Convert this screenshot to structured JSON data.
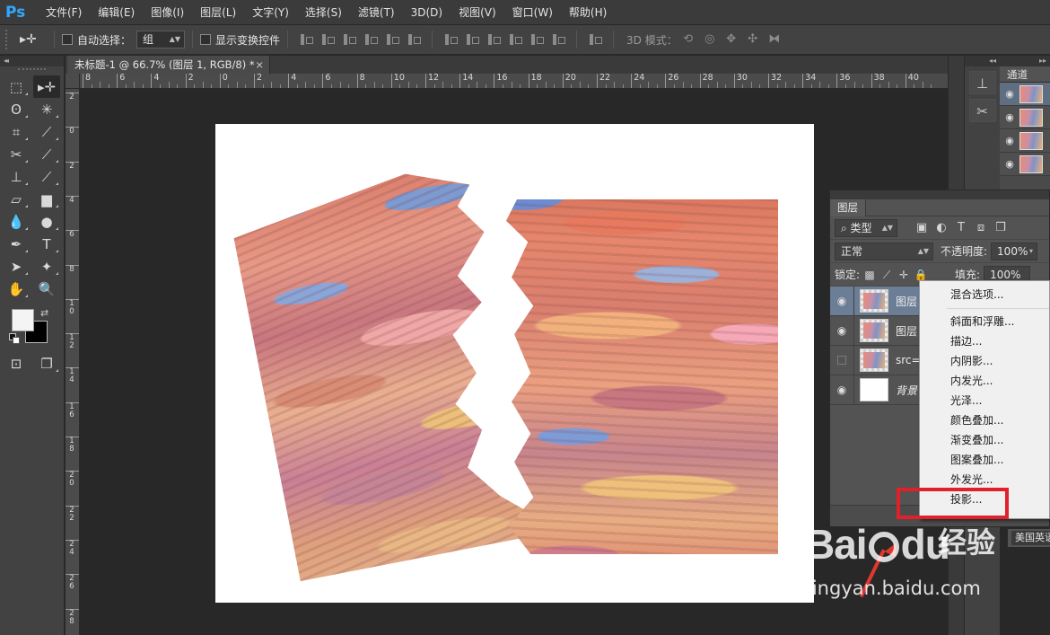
{
  "app": {
    "logo": "Ps"
  },
  "menu": [
    "文件(F)",
    "编辑(E)",
    "图像(I)",
    "图层(L)",
    "文字(Y)",
    "选择(S)",
    "滤镜(T)",
    "3D(D)",
    "视图(V)",
    "窗口(W)",
    "帮助(H)"
  ],
  "options": {
    "auto_select_label": "自动选择：",
    "auto_select_value": "组",
    "show_transform_label": "显示变换控件",
    "mode_label": "3D 模式："
  },
  "document": {
    "tab_title": "未标题-1 @ 66.7% (图层 1, RGB/8) *",
    "close": "×"
  },
  "ruler": {
    "h_ticks": [
      "8",
      "6",
      "4",
      "2",
      "0",
      "2",
      "4",
      "6",
      "8",
      "10",
      "12",
      "14",
      "16",
      "18",
      "20",
      "22",
      "24",
      "26",
      "28",
      "30",
      "32",
      "34",
      "36",
      "38",
      "40"
    ],
    "v_ticks": [
      [
        "2"
      ],
      [
        "0"
      ],
      [
        "2"
      ],
      [
        "4"
      ],
      [
        "6"
      ],
      [
        "8"
      ],
      [
        "1",
        "0"
      ],
      [
        "1",
        "2"
      ],
      [
        "1",
        "4"
      ],
      [
        "1",
        "6"
      ],
      [
        "1",
        "8"
      ],
      [
        "2",
        "0"
      ],
      [
        "2",
        "2"
      ],
      [
        "2",
        "4"
      ],
      [
        "2",
        "6"
      ],
      [
        "2",
        "8"
      ]
    ]
  },
  "channels": {
    "tab": "通道"
  },
  "layers_panel": {
    "tab": "图层",
    "filter_type": "类型",
    "blend_mode": "正常",
    "opacity_label": "不透明度:",
    "opacity_value": "100%",
    "lock_label": "锁定:",
    "fill_label": "填充:",
    "fill_value": "100%",
    "layers": [
      {
        "name": "图层",
        "visible": true,
        "selected": true
      },
      {
        "name": "图层",
        "visible": true,
        "selected": false
      },
      {
        "name": "src=",
        "visible": false,
        "selected": false
      },
      {
        "name": "背景",
        "visible": true,
        "selected": false,
        "italic": true
      }
    ]
  },
  "context_menu": {
    "items": [
      "混合选项...",
      "斜面和浮雕...",
      "描边...",
      "内阴影...",
      "内发光...",
      "光泽...",
      "颜色叠加...",
      "渐变叠加...",
      "图案叠加...",
      "外发光...",
      "投影..."
    ],
    "highlighted": "投影..."
  },
  "language_label": "美国英语",
  "watermark": {
    "brand_left": "Bai",
    "brand_right": "经验",
    "brand_mid": "du",
    "url": "jingyan.baidu.com"
  },
  "colors": {
    "highlight_box": "#e0202a",
    "selected_layer": "#6b7e96",
    "ps_blue": "#31a8ff"
  }
}
